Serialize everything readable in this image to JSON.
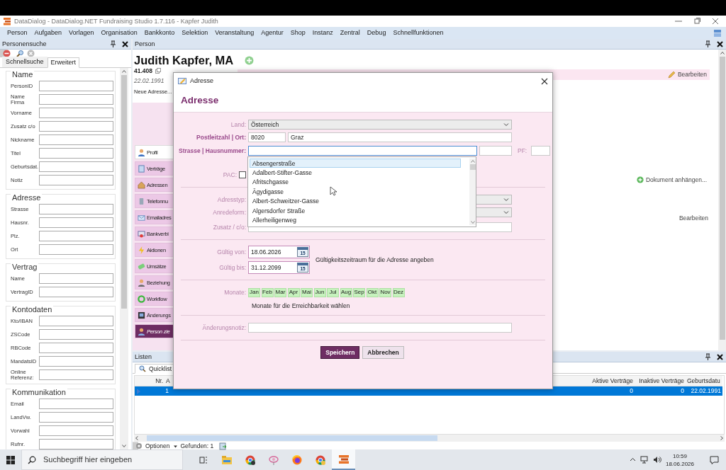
{
  "window": {
    "title": "DataDialog - DataDialog.NET Fundraising Studio 1.7.116 - Kapfer Judith"
  },
  "menu": [
    "Person",
    "Aufgaben",
    "Vorlagen",
    "Organisation",
    "Bankkonto",
    "Selektion",
    "Veranstaltung",
    "Agentur",
    "Shop",
    "Instanz",
    "Zentral",
    "Debug",
    "Schnellfunktionen"
  ],
  "search_panel": {
    "title": "Personensuche",
    "tabs": [
      {
        "label": "Schnellsuche",
        "selected": false
      },
      {
        "label": "Erweitert",
        "selected": true
      }
    ],
    "groups": [
      {
        "title": "Name",
        "fields": [
          {
            "label": "PersonID"
          },
          {
            "label": "Name Firma"
          },
          {
            "label": "Vorname"
          },
          {
            "label": "Zusatz c/o"
          },
          {
            "label": "Nickname"
          },
          {
            "label": "Titel"
          },
          {
            "label": "Geburtsdat."
          },
          {
            "label": "Notiz"
          }
        ]
      },
      {
        "title": "Adresse",
        "fields": [
          {
            "label": "Strasse"
          },
          {
            "label": "Hausnr."
          },
          {
            "label": "Plz."
          },
          {
            "label": "Ort"
          }
        ]
      },
      {
        "title": "Vertrag",
        "fields": [
          {
            "label": "Name"
          },
          {
            "label": "VertragID"
          }
        ]
      },
      {
        "title": "Kontodaten",
        "fields": [
          {
            "label": "Kto/IBAN"
          },
          {
            "label": "ZSCode"
          },
          {
            "label": "RBCode"
          },
          {
            "label": "MandatsID"
          },
          {
            "label": "Online Referenz:"
          }
        ]
      },
      {
        "title": "Kommunikation",
        "fields": [
          {
            "label": "Email"
          },
          {
            "label": "LandVw."
          },
          {
            "label": "Vorwahl"
          },
          {
            "label": "Rufnr."
          }
        ]
      }
    ]
  },
  "person_panel": {
    "title": "Person",
    "name": "Judith Kapfer, MA",
    "number": "41.408",
    "birth_date": "22.02.1991",
    "new_address": "Neue Adresse...",
    "edit": "Bearbeiten",
    "nav": [
      {
        "label": "Profil",
        "selected": true
      },
      {
        "label": "Verträge",
        "selected": false
      },
      {
        "label": "Adressen",
        "selected": false
      },
      {
        "label": "Telefonnu",
        "selected": false
      },
      {
        "label": "Emailadres",
        "selected": false
      },
      {
        "label": "Bankverbi",
        "selected": false
      },
      {
        "label": "Aktionen",
        "selected": false
      },
      {
        "label": "Umsätze",
        "selected": false
      },
      {
        "label": "Beziehung",
        "selected": false
      },
      {
        "label": "Workflow",
        "selected": false
      },
      {
        "label": "Änderungs",
        "selected": false
      },
      {
        "label": "Person zie",
        "selected": false,
        "kind": "action"
      }
    ],
    "attach": "Dokument anhängen...",
    "edit_2": "Bearbeiten"
  },
  "dialog": {
    "title": "Adresse",
    "heading": "Adresse",
    "country": {
      "label": "Land:",
      "value": "Österreich"
    },
    "postal": {
      "label": "Postleitzahl | Ort:",
      "zip": "8020",
      "city": "Graz"
    },
    "street": {
      "label": "Strasse | Hausnummer:",
      "pf_label": "PF:"
    },
    "street_suggestions": [
      {
        "label": "Absengerstraße",
        "selected": true
      },
      {
        "label": "Adalbert-Stifter-Gasse",
        "selected": false
      },
      {
        "label": "Afritschgasse",
        "selected": false
      },
      {
        "label": "Ägydigasse",
        "selected": false
      },
      {
        "label": "Albert-Schweitzer-Gasse",
        "selected": false
      },
      {
        "label": "Algersdorfer Straße",
        "selected": false
      },
      {
        "label": "Allerheiligenweg",
        "selected": false
      }
    ],
    "pac": {
      "label": "PAC:",
      "checked": false
    },
    "address_type": {
      "label": "Adresstyp:"
    },
    "salutation": {
      "label": "Anredeform:"
    },
    "addition": {
      "label": "Zusatz / c/o:"
    },
    "valid_from": {
      "label": "Gültig von:",
      "value": "18.06.2026",
      "calendar": "15"
    },
    "valid_to": {
      "label": "Gültig bis:",
      "value": "31.12.2099",
      "calendar": "15"
    },
    "validity_hint": "Gültigkeitszeitraum für die Adresse angeben",
    "months": {
      "label": "Monate:",
      "hint": "Monate für die Erreichbarkeit wählen",
      "items": [
        {
          "label": "Jan",
          "selected": true
        },
        {
          "label": "Feb",
          "selected": true
        },
        {
          "label": "Mar",
          "selected": true
        },
        {
          "label": "Apr",
          "selected": true
        },
        {
          "label": "Mai",
          "selected": true
        },
        {
          "label": "Jun",
          "selected": true
        },
        {
          "label": "Jul",
          "selected": true
        },
        {
          "label": "Aug",
          "selected": true
        },
        {
          "label": "Sep",
          "selected": true
        },
        {
          "label": "Okt",
          "selected": true
        },
        {
          "label": "Nov",
          "selected": true
        },
        {
          "label": "Dez",
          "selected": true
        }
      ]
    },
    "change_note": {
      "label": "Änderungsnotiz:"
    },
    "buttons": [
      {
        "label": "Speichern",
        "kind": "primary"
      },
      {
        "label": "Abbrechen",
        "kind": "secondary"
      }
    ]
  },
  "lists_panel": {
    "title": "Listen",
    "tab": "Quicklist",
    "columns": [
      "Nr.",
      "A",
      "Aktive Verträge",
      "Inaktive Verträge",
      "Geburtsdatu"
    ],
    "rows": [
      {
        "selected": true,
        "nr": "1",
        "active": "0",
        "inactive": "0",
        "birth_date": "22.02.1991"
      }
    ],
    "options": "Optionen",
    "found": "Gefunden: 1"
  },
  "taskbar": {
    "search_placeholder": "Suchbegriff hier eingeben",
    "time": "10:59",
    "date": "18.06.2026",
    "apps": [
      {
        "active": false
      },
      {
        "active": false
      },
      {
        "active": false
      },
      {
        "active": false
      },
      {
        "active": false
      },
      {
        "active": true
      }
    ]
  }
}
